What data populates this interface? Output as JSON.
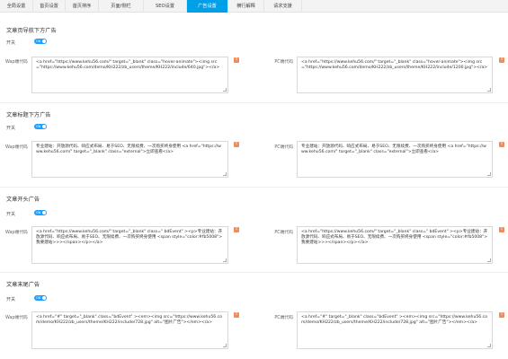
{
  "tabs": [
    {
      "label": "全局设置",
      "active": false
    },
    {
      "label": "首页设置",
      "active": false
    },
    {
      "label": "首页排序",
      "active": false
    },
    {
      "label": "页面/侧栏",
      "active": false
    },
    {
      "label": "SEO设置",
      "active": false
    },
    {
      "label": "广告设置",
      "active": true
    },
    {
      "label": "横行解释",
      "active": false
    },
    {
      "label": "请求支援",
      "active": false
    }
  ],
  "colors": {
    "accent": "#00a0e9",
    "switch": "#1e9fff",
    "warn": "#f08c5a"
  },
  "common": {
    "switch_label": "开关",
    "switch_state": "ON",
    "wap_label": "Wap端代码",
    "pc_label": "PC端代码",
    "warn_icon": "warning-icon"
  },
  "sections": [
    {
      "title": "文章页导航下方广告",
      "wap_code": "<a href=\"https://www.kehu56.com/\" target=\"_blank\" class=\"hover-animate\"><img src=\"https://www.kehu56.com/demo/KH222/zb_users/theme/KH222/include/640.jpg\"></a>",
      "pc_code": "<a href=\"https://www.kehu56.com/\" target=\"_blank\" class=\"hover-animate\"><img src=\"https://www.kehu56.com/demo/KH222/zb_users/theme/KH222/include/1200.jpg\"></a>"
    },
    {
      "title": "文章标题下方广告",
      "wap_code": "专业建站：开放源代码、响应式布局、易于SEO、无限续费、一次购买终身使用 <a href=\"https://www.kehu56.com/\" target=\"_blank\" class=\"external\">立即查看</a>",
      "pc_code": "专业建站：开放源代码、响应式布局、易于SEO、无限续费、一次购买终身使用 <a href=\"https://www.kehu56.com/\" target=\"_blank\" class=\"external\">立即查看</a>"
    },
    {
      "title": "文章开头广告",
      "wap_code": "<a href=\"https://www.kehu56.com/\" target=\"_blank\" class=\" bdEvent\" ><p>专业建站：开放源代码、响应式布局、易于SEO、无限续费、一次购买终身使用 <span style=\"color:#fb5008\">我要建站>>></span></p></a>",
      "pc_code": "<a href=\"https://www.kehu56.com/\" target=\"_blank\" class=\" bdEvent\" ><p>专业建站：开放源代码、响应式布局、易于SEO、无限续费、一次购买终身使用 <span style=\"color:#fb5008\">我要建站>>></span></p></a>"
    },
    {
      "title": "文章末尾广告",
      "wap_code": "<a href=\"#\" target=\"_blank\" class=\"bdEvent\" ><em><img src=\"https://www.kehu56.com/demo/KH222/zb_users/theme/KH222/include/728.jpg\" alt=\"图片广告\"></em></a>",
      "pc_code": "<a href=\"#\" target=\"_blank\" class=\"bdEvent\" ><em><img src=\"https://www.kehu56.com/demo/KH222/zb_users/theme/KH222/include/728.jpg\" alt=\"图片广告\"></em></a>"
    }
  ]
}
